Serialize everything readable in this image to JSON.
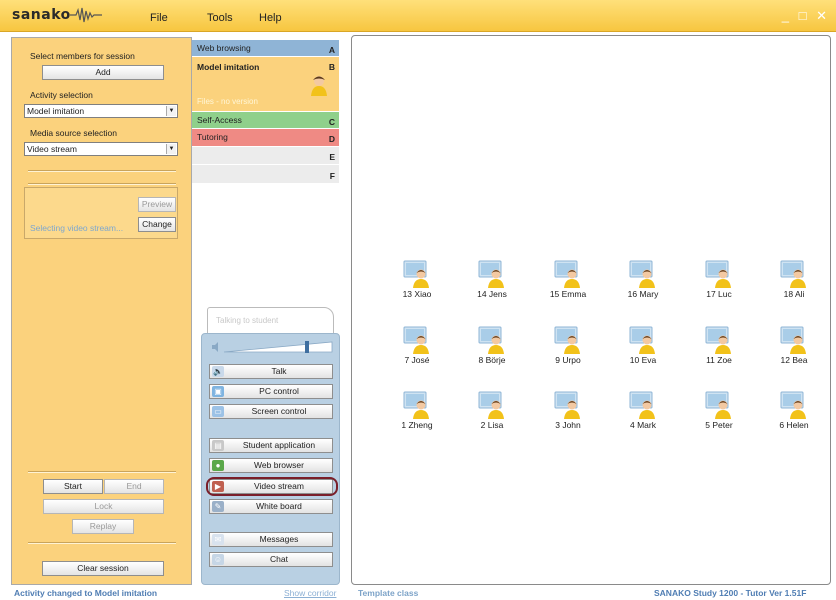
{
  "app": {
    "logo": "sanako",
    "menu": [
      "File",
      "Tools",
      "Help"
    ],
    "window_controls": "_ □ ✕"
  },
  "left_panel": {
    "select_members_label": "Select members for session",
    "add_button": "Add",
    "activity_label": "Activity selection",
    "activity_value": "Model imitation",
    "media_label": "Media source selection",
    "media_value": "Video stream",
    "preview_button": "Preview",
    "change_button": "Change",
    "selecting_text": "Selecting video stream...",
    "start_button": "Start",
    "end_button": "End",
    "lock_button": "Lock",
    "replay_button": "Replay",
    "clear_button": "Clear session"
  },
  "activities": [
    {
      "label": "Web browsing",
      "key": "A",
      "color": "#8fb4d6"
    },
    {
      "label": "Model imitation",
      "key": "B",
      "color": "#fbd27d",
      "sub": "Files - no version"
    },
    {
      "label": "Self-Access",
      "key": "C",
      "color": "#8fd08b"
    },
    {
      "label": "Tutoring",
      "key": "D",
      "color": "#ef8a84"
    },
    {
      "label": "",
      "key": "E",
      "color": "#ececec"
    },
    {
      "label": "",
      "key": "F",
      "color": "#ececec"
    }
  ],
  "controls": {
    "talking_tab": "Talking to student",
    "buttons": [
      {
        "label": "Talk",
        "icon": "speaker-icon"
      },
      {
        "label": "PC control",
        "icon": "pc-icon"
      },
      {
        "label": "Screen control",
        "icon": "screen-icon"
      },
      {
        "label": "Student application",
        "icon": "app-icon"
      },
      {
        "label": "Web browser",
        "icon": "globe-icon"
      },
      {
        "label": "Video stream",
        "icon": "video-icon"
      },
      {
        "label": "White board",
        "icon": "whiteboard-icon"
      },
      {
        "label": "Messages",
        "icon": "message-icon"
      },
      {
        "label": "Chat",
        "icon": "chat-icon"
      }
    ],
    "volume_level": 0.85
  },
  "students": [
    [
      "13 Xiao",
      "14 Jens",
      "15 Emma",
      "16 Mary",
      "17 Luc",
      "18 Ali"
    ],
    [
      "7 José",
      "8 Börje",
      "9 Urpo",
      "10 Eva",
      "11 Zoe",
      "12 Bea"
    ],
    [
      "1 Zheng",
      "2 Lisa",
      "3 John",
      "4 Mark",
      "5 Peter",
      "6 Helen"
    ]
  ],
  "status": {
    "left": "Activity changed to Model imitation",
    "link": "Show corridor",
    "center": "Template class",
    "right": "SANAKO Study 1200 - Tutor Ver 1.51F"
  },
  "colors": {
    "accent": "#f7c640",
    "panel": "#fbd27d",
    "status_text": "#4f7db3"
  }
}
